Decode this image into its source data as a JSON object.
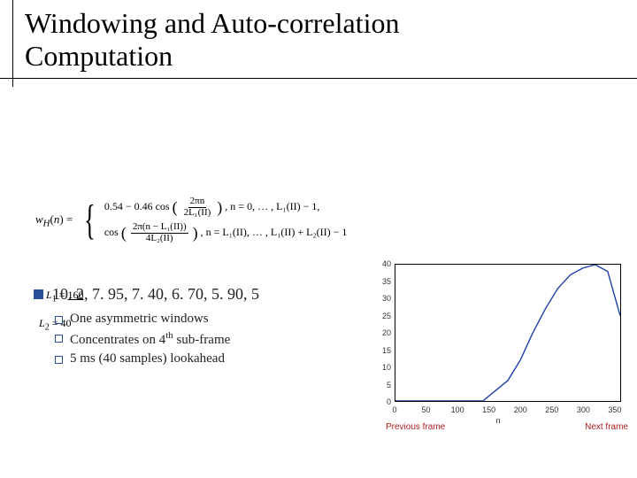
{
  "title_line1": "Windowing and Auto-correlation",
  "title_line2": "Computation",
  "formula": {
    "lhs": "w_H(n) =",
    "case1_left": "0.54 − 0.46 cos",
    "case1_frac_num": "2πn",
    "case1_frac_den": "2L₁(II)",
    "case1_right": ",   n = 0, … , L₁(II) − 1,",
    "case2_left": "cos",
    "case2_frac_num": "2π(n − L₁(II))",
    "case2_frac_den": "4L₂(II)",
    "case2_right": ",   n = L₁(II), … , L₁(II) + L₂(II) − 1"
  },
  "L1_text": "L₁ = 160",
  "L2_text": "L₂ = 40",
  "numbers_row": "10. 2, 7. 95, 7. 40, 6. 70, 5. 90, 5",
  "bullets": {
    "b1": "One asymmetric windows",
    "b2_pre": "Concentrates on 4",
    "b2_sup": "th",
    "b2_post": " sub-frame",
    "b3": "5 ms (40 samples) lookahead"
  },
  "chart_data": {
    "type": "line",
    "xlabel": "n",
    "xlim": [
      0,
      360
    ],
    "ylim": [
      0,
      40
    ],
    "xticks": [
      0,
      50,
      100,
      150,
      200,
      250,
      300,
      350
    ],
    "yticks": [
      0,
      5,
      10,
      15,
      20,
      25,
      30,
      35,
      40
    ],
    "x": [
      0,
      20,
      40,
      60,
      80,
      100,
      120,
      140,
      160,
      180,
      200,
      220,
      240,
      260,
      280,
      300,
      320,
      340,
      360
    ],
    "values": [
      0,
      0,
      0,
      0,
      0,
      0,
      0,
      0,
      3,
      6,
      12,
      20,
      27,
      33,
      37,
      39,
      40,
      38,
      25
    ],
    "caption_left": "Previous frame",
    "caption_right": "Next frame"
  }
}
